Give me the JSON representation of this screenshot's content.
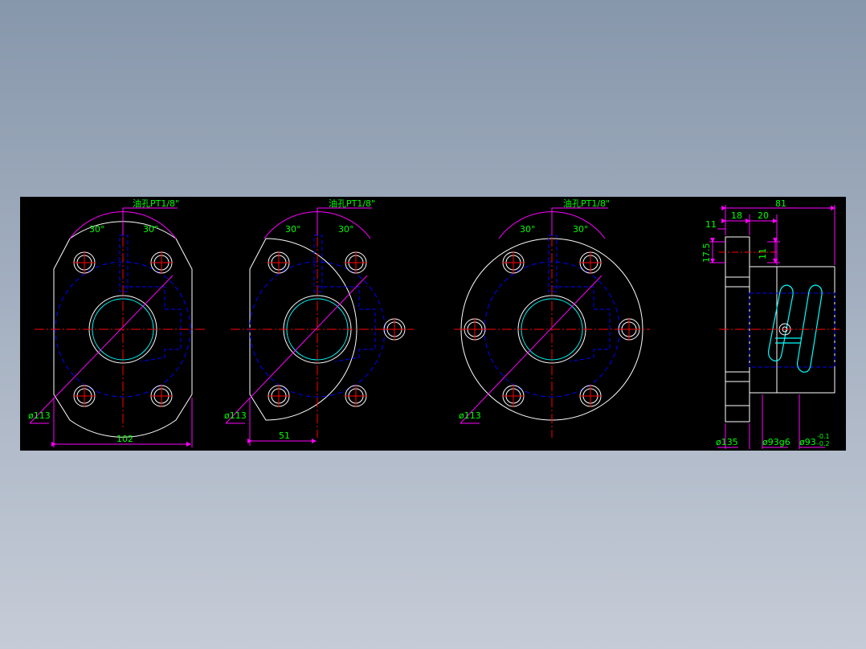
{
  "colors": {
    "background": "#000000",
    "outline": "#ffffff",
    "centerline": "#ff0000",
    "hidden": "#0000ff",
    "dimension": "#ff00ff",
    "dimension_text": "#00ff00",
    "thread": "#00ffff"
  },
  "views": [
    {
      "oil_hole": "油孔PT1/8\"",
      "angle_left": "30°",
      "angle_right": "30°",
      "pcd": "ø113",
      "width": "102"
    },
    {
      "oil_hole": "油孔PT1/8\"",
      "angle_left": "30°",
      "angle_right": "30°",
      "pcd": "ø113",
      "width": "51"
    },
    {
      "oil_hole": "油孔PT1/8\"",
      "angle_left": "30°",
      "angle_right": "30°",
      "pcd": "ø113"
    }
  ],
  "side_view": {
    "total_length": "81",
    "dim_11_top": "11",
    "dim_18": "18",
    "dim_20": "20",
    "dim_17_5": "17.5",
    "dim_11_vertical": "11",
    "flange_dia": "ø135",
    "body_dia": "ø93g6",
    "nut_dia": "ø93",
    "tol_upper": "-0.1",
    "tol_lower": "-0.2"
  }
}
